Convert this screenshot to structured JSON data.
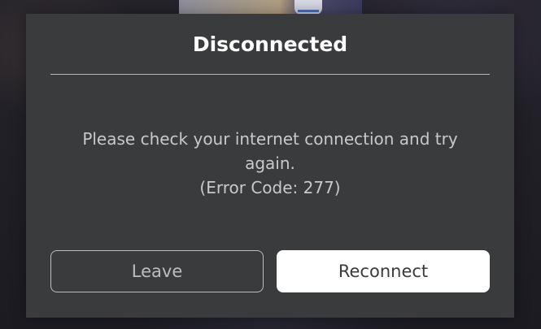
{
  "dialog": {
    "title": "Disconnected",
    "message_line1": "Please check your internet connection and try",
    "message_line2": "again.",
    "error_code": "(Error Code: 277)"
  },
  "buttons": {
    "leave_label": "Leave",
    "reconnect_label": "Reconnect"
  },
  "colors": {
    "dialog_background": "#393b3d",
    "title_text": "#ffffff",
    "message_text": "#c9c9c9",
    "secondary_button_outline": "#bdbdbd",
    "primary_button_fill": "#ffffff"
  }
}
